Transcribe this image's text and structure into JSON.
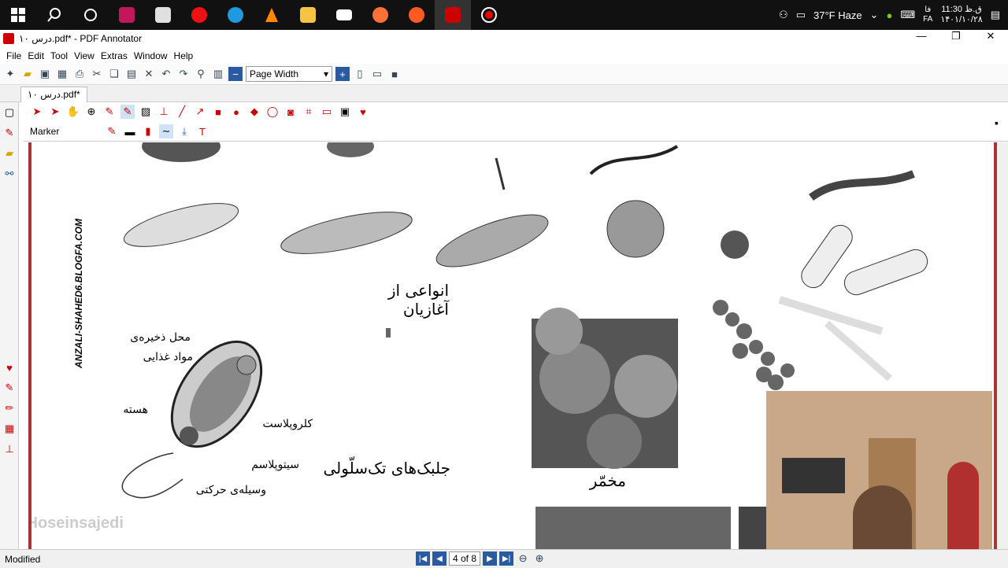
{
  "taskbar": {
    "weather": "37°F  Haze",
    "time": "11:30 ق.ظ",
    "date": "۱۴۰۱/۱۰/۲۸",
    "lang": "FA",
    "lang_label": "فا"
  },
  "window": {
    "title": "درس ۱۰.pdf* - PDF Annotator",
    "tab": "درس ۱۰.pdf*"
  },
  "menu": [
    "File",
    "Edit",
    "Tool",
    "View",
    "Extras",
    "Window",
    "Help"
  ],
  "toolbar": {
    "zoom": "Page Width"
  },
  "annotbar": {
    "tool": "Marker"
  },
  "page": {
    "label_protists": "انواعی از آغازیان",
    "label_euglena": "جلبک‌های تک‌سلّولی",
    "label_yeast": "مخمّر",
    "label_storage_1": "محل ذخیره‌ی",
    "label_storage_2": "مواد غذایی",
    "label_nucleus": "هسته",
    "label_chloroplast": "کلروپلاست",
    "label_cytoplasm": "سیتوپلاسم",
    "label_flagellum": "وسیله‌ی حرکتی",
    "side_text": "ANZALI-SHAHED6.BLOGFA.COM",
    "watermark": "@Hoseinsajedi"
  },
  "status": {
    "modified": "Modified",
    "page": "4 of 8"
  }
}
